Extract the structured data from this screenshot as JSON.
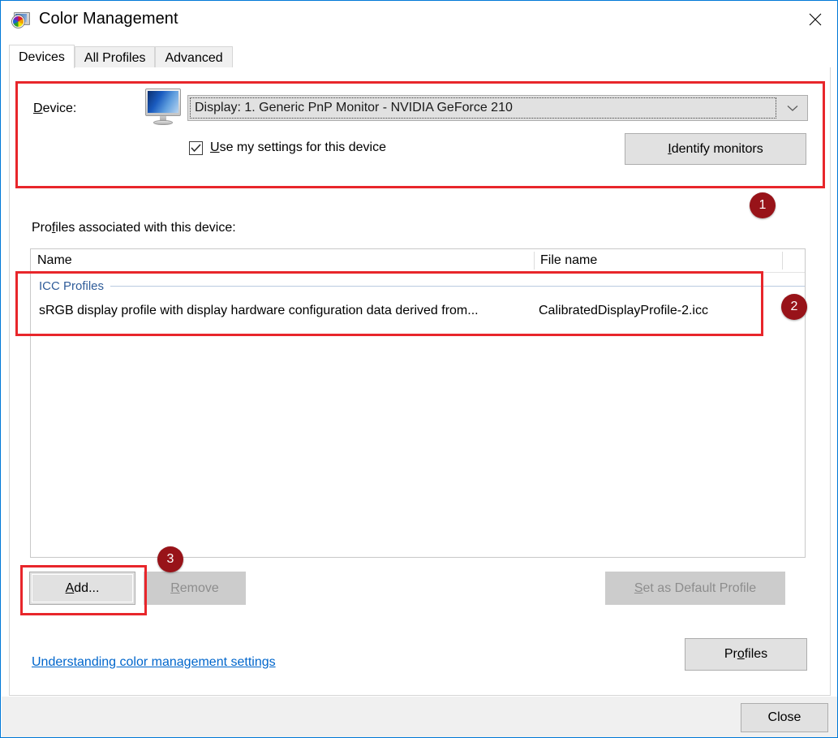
{
  "window": {
    "title": "Color Management",
    "icon": "color-management-icon",
    "close_icon": "close-icon",
    "accent_color": "#0078d7"
  },
  "tabs": [
    {
      "label": "Devices",
      "active": true
    },
    {
      "label": "All Profiles",
      "active": false
    },
    {
      "label": "Advanced",
      "active": false
    }
  ],
  "device_section": {
    "label": "Device:",
    "label_prefix": "D",
    "label_rest": "evice:",
    "device_icon": "monitor-icon",
    "combo_value": "Display: 1. Generic PnP Monitor - NVIDIA GeForce 210",
    "combo_arrow_icon": "chevron-down-icon",
    "checkbox": {
      "checked": true,
      "label_prefix": "U",
      "label_rest": "se my settings for this device",
      "label": "Use my settings for this device"
    },
    "identify_button": {
      "label": "Identify monitors",
      "label_prefix": "I",
      "label_rest": "dentify monitors",
      "disabled": false
    }
  },
  "profiles_section": {
    "label": "Profiles associated with this device:",
    "label_part1": "Pro",
    "label_accel": "f",
    "label_part2": "iles associated with this device:",
    "columns": [
      "Name",
      "File name",
      ""
    ],
    "group_title": "ICC Profiles",
    "rows": [
      {
        "name": "sRGB display profile with display hardware configuration data derived from...",
        "file_name": "CalibratedDisplayProfile-2.icc"
      }
    ]
  },
  "buttons": {
    "add": {
      "label": "Add...",
      "label_prefix": "A",
      "label_rest": "dd...",
      "disabled": false,
      "focused": true
    },
    "remove": {
      "label": "Remove",
      "label_prefix": "R",
      "label_rest": "emove",
      "disabled": true
    },
    "set_default": {
      "label": "Set as Default Profile",
      "label_prefix": "S",
      "label_rest": "et as Default Profile",
      "disabled": true
    },
    "profiles": {
      "label": "Profiles",
      "label_part1": "Pr",
      "label_accel": "o",
      "label_part2": "files",
      "disabled": false
    },
    "close": {
      "label": "Close",
      "disabled": false
    }
  },
  "help_link": {
    "label": "Understanding color management settings",
    "color": "#0066cc"
  },
  "annotations": {
    "highlight_color": "#e8262b",
    "badge_color": "#981319",
    "badges": [
      {
        "number": "1",
        "target": "device-section"
      },
      {
        "number": "2",
        "target": "profile-row"
      },
      {
        "number": "3",
        "target": "add-button"
      }
    ]
  }
}
